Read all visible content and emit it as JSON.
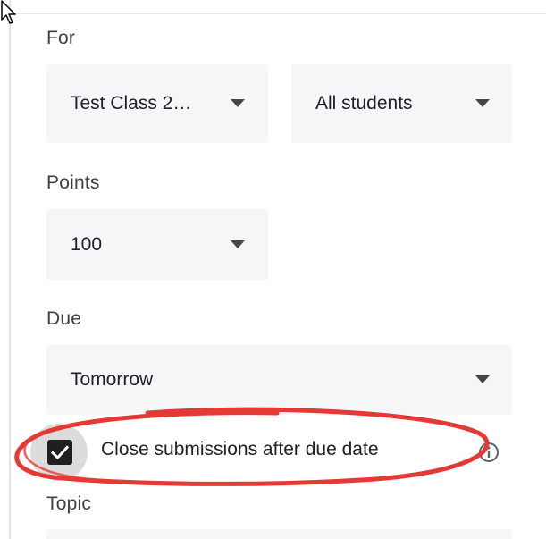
{
  "colors": {
    "accent_annotation": "#e53935",
    "field_background": "#f5f6f8",
    "label_text": "#3c4043",
    "checkbox_fill": "#1f1f1f"
  },
  "cursor": {
    "icon": "arrow-cursor-icon"
  },
  "for_section": {
    "label": "For",
    "class_select": {
      "value": "Test Class 2…",
      "icon": "dropdown-arrow-icon"
    },
    "students_select": {
      "value": "All students",
      "icon": "dropdown-arrow-icon"
    }
  },
  "points_section": {
    "label": "Points",
    "points_select": {
      "value": "100",
      "icon": "dropdown-arrow-icon"
    }
  },
  "due_section": {
    "label": "Due",
    "due_select": {
      "value": "Tomorrow",
      "icon": "dropdown-arrow-icon"
    },
    "close_submissions": {
      "label": "Close submissions after due date",
      "checked": true,
      "info_icon": "info-icon"
    }
  },
  "topic_section": {
    "label": "Topic"
  }
}
